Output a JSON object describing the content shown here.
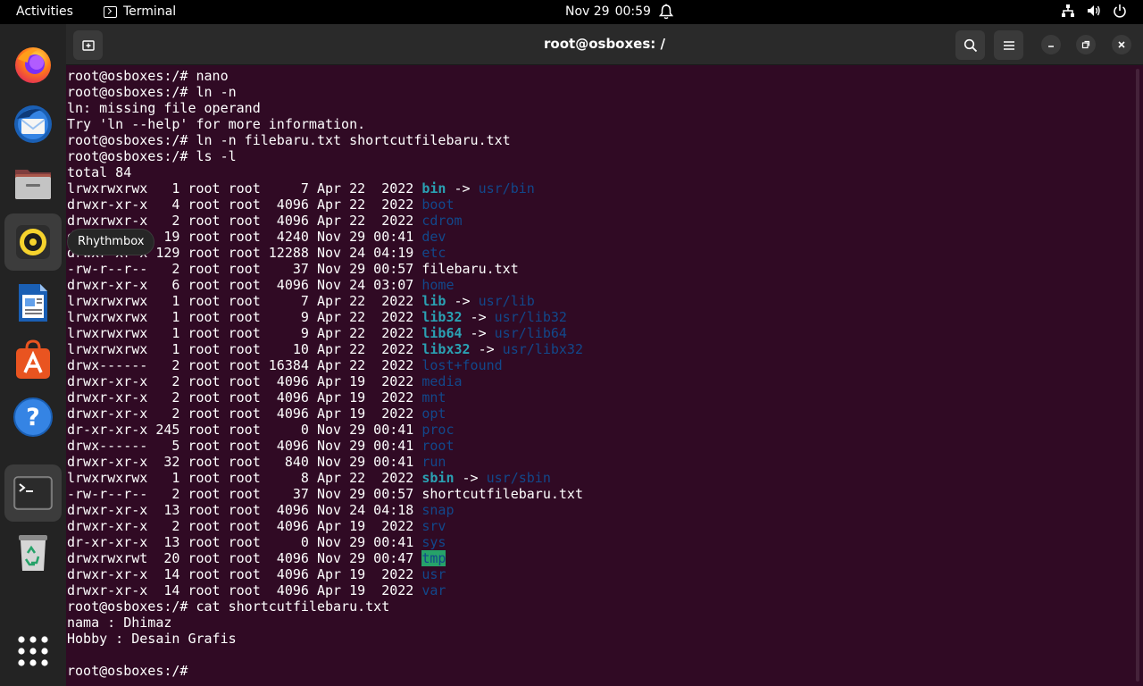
{
  "topbar": {
    "activities": "Activities",
    "app_name": "Terminal",
    "date": "Nov 29",
    "time": "00:59"
  },
  "dock": {
    "tooltip": "Rhythmbox",
    "apps": [
      "Firefox",
      "Thunderbird",
      "Files",
      "Rhythmbox",
      "LibreOffice Writer",
      "Ubuntu Software",
      "Help",
      "Terminal",
      "Trash",
      "Show Applications"
    ]
  },
  "window": {
    "title": "root@osboxes: /"
  },
  "terminal": {
    "pre_lines": [
      "root@osboxes:/# nano",
      "root@osboxes:/# ln -n",
      "ln: missing file operand",
      "Try 'ln --help' for more information.",
      "root@osboxes:/# ln -n filebaru.txt shortcutfilebaru.txt",
      "root@osboxes:/# ls -l",
      "total 84"
    ],
    "listing": [
      {
        "meta": "lrwxrwxrwx   1 root root     7 Apr 22  2022 ",
        "name": "bin",
        "kind": "link",
        "target": "usr/bin"
      },
      {
        "meta": "drwxr-xr-x   4 root root  4096 Apr 22  2022 ",
        "name": "boot",
        "kind": "dir"
      },
      {
        "meta": "drwxrwxr-x   2 root root  4096 Apr 22  2022 ",
        "name": "cdrom",
        "kind": "dir"
      },
      {
        "meta": "drwxr-xr-x  19 root root  4240 Nov 29 00:41 ",
        "name": "dev",
        "kind": "dir"
      },
      {
        "meta": "drwxr-xr-x 129 root root 12288 Nov 24 04:19 ",
        "name": "etc",
        "kind": "dir"
      },
      {
        "meta": "-rw-r--r--   2 root root    37 Nov 29 00:57 ",
        "name": "filebaru.txt",
        "kind": "file"
      },
      {
        "meta": "drwxr-xr-x   6 root root  4096 Nov 24 03:07 ",
        "name": "home",
        "kind": "dir"
      },
      {
        "meta": "lrwxrwxrwx   1 root root     7 Apr 22  2022 ",
        "name": "lib",
        "kind": "link",
        "target": "usr/lib"
      },
      {
        "meta": "lrwxrwxrwx   1 root root     9 Apr 22  2022 ",
        "name": "lib32",
        "kind": "link",
        "target": "usr/lib32"
      },
      {
        "meta": "lrwxrwxrwx   1 root root     9 Apr 22  2022 ",
        "name": "lib64",
        "kind": "link",
        "target": "usr/lib64"
      },
      {
        "meta": "lrwxrwxrwx   1 root root    10 Apr 22  2022 ",
        "name": "libx32",
        "kind": "link",
        "target": "usr/libx32"
      },
      {
        "meta": "drwx------   2 root root 16384 Apr 22  2022 ",
        "name": "lost+found",
        "kind": "dir"
      },
      {
        "meta": "drwxr-xr-x   2 root root  4096 Apr 19  2022 ",
        "name": "media",
        "kind": "dir"
      },
      {
        "meta": "drwxr-xr-x   2 root root  4096 Apr 19  2022 ",
        "name": "mnt",
        "kind": "dir"
      },
      {
        "meta": "drwxr-xr-x   2 root root  4096 Apr 19  2022 ",
        "name": "opt",
        "kind": "dir"
      },
      {
        "meta": "dr-xr-xr-x 245 root root     0 Nov 29 00:41 ",
        "name": "proc",
        "kind": "dir"
      },
      {
        "meta": "drwx------   5 root root  4096 Nov 29 00:41 ",
        "name": "root",
        "kind": "dir"
      },
      {
        "meta": "drwxr-xr-x  32 root root   840 Nov 29 00:41 ",
        "name": "run",
        "kind": "dir"
      },
      {
        "meta": "lrwxrwxrwx   1 root root     8 Apr 22  2022 ",
        "name": "sbin",
        "kind": "link",
        "target": "usr/sbin"
      },
      {
        "meta": "-rw-r--r--   2 root root    37 Nov 29 00:57 ",
        "name": "shortcutfilebaru.txt",
        "kind": "file"
      },
      {
        "meta": "drwxr-xr-x  13 root root  4096 Nov 24 04:18 ",
        "name": "snap",
        "kind": "dir"
      },
      {
        "meta": "drwxr-xr-x   2 root root  4096 Apr 19  2022 ",
        "name": "srv",
        "kind": "dir"
      },
      {
        "meta": "dr-xr-xr-x  13 root root     0 Nov 29 00:41 ",
        "name": "sys",
        "kind": "dir"
      },
      {
        "meta": "drwxrwxrwt  20 root root  4096 Nov 29 00:47 ",
        "name": "tmp",
        "kind": "sticky"
      },
      {
        "meta": "drwxr-xr-x  14 root root  4096 Apr 19  2022 ",
        "name": "usr",
        "kind": "dir"
      },
      {
        "meta": "drwxr-xr-x  14 root root  4096 Apr 19  2022 ",
        "name": "var",
        "kind": "dir"
      }
    ],
    "arrow": " -> ",
    "post_lines": [
      "root@osboxes:/# cat shortcutfilebaru.txt",
      "nama : Dhimaz",
      "Hobby : Desain Grafis",
      "",
      "root@osboxes:/# "
    ]
  },
  "colors": {
    "terminal_bg": "#300a24",
    "directory": "#12488b",
    "symlink": "#2aa1b3",
    "sticky_bg": "#26a269",
    "accent": "#e95420"
  }
}
